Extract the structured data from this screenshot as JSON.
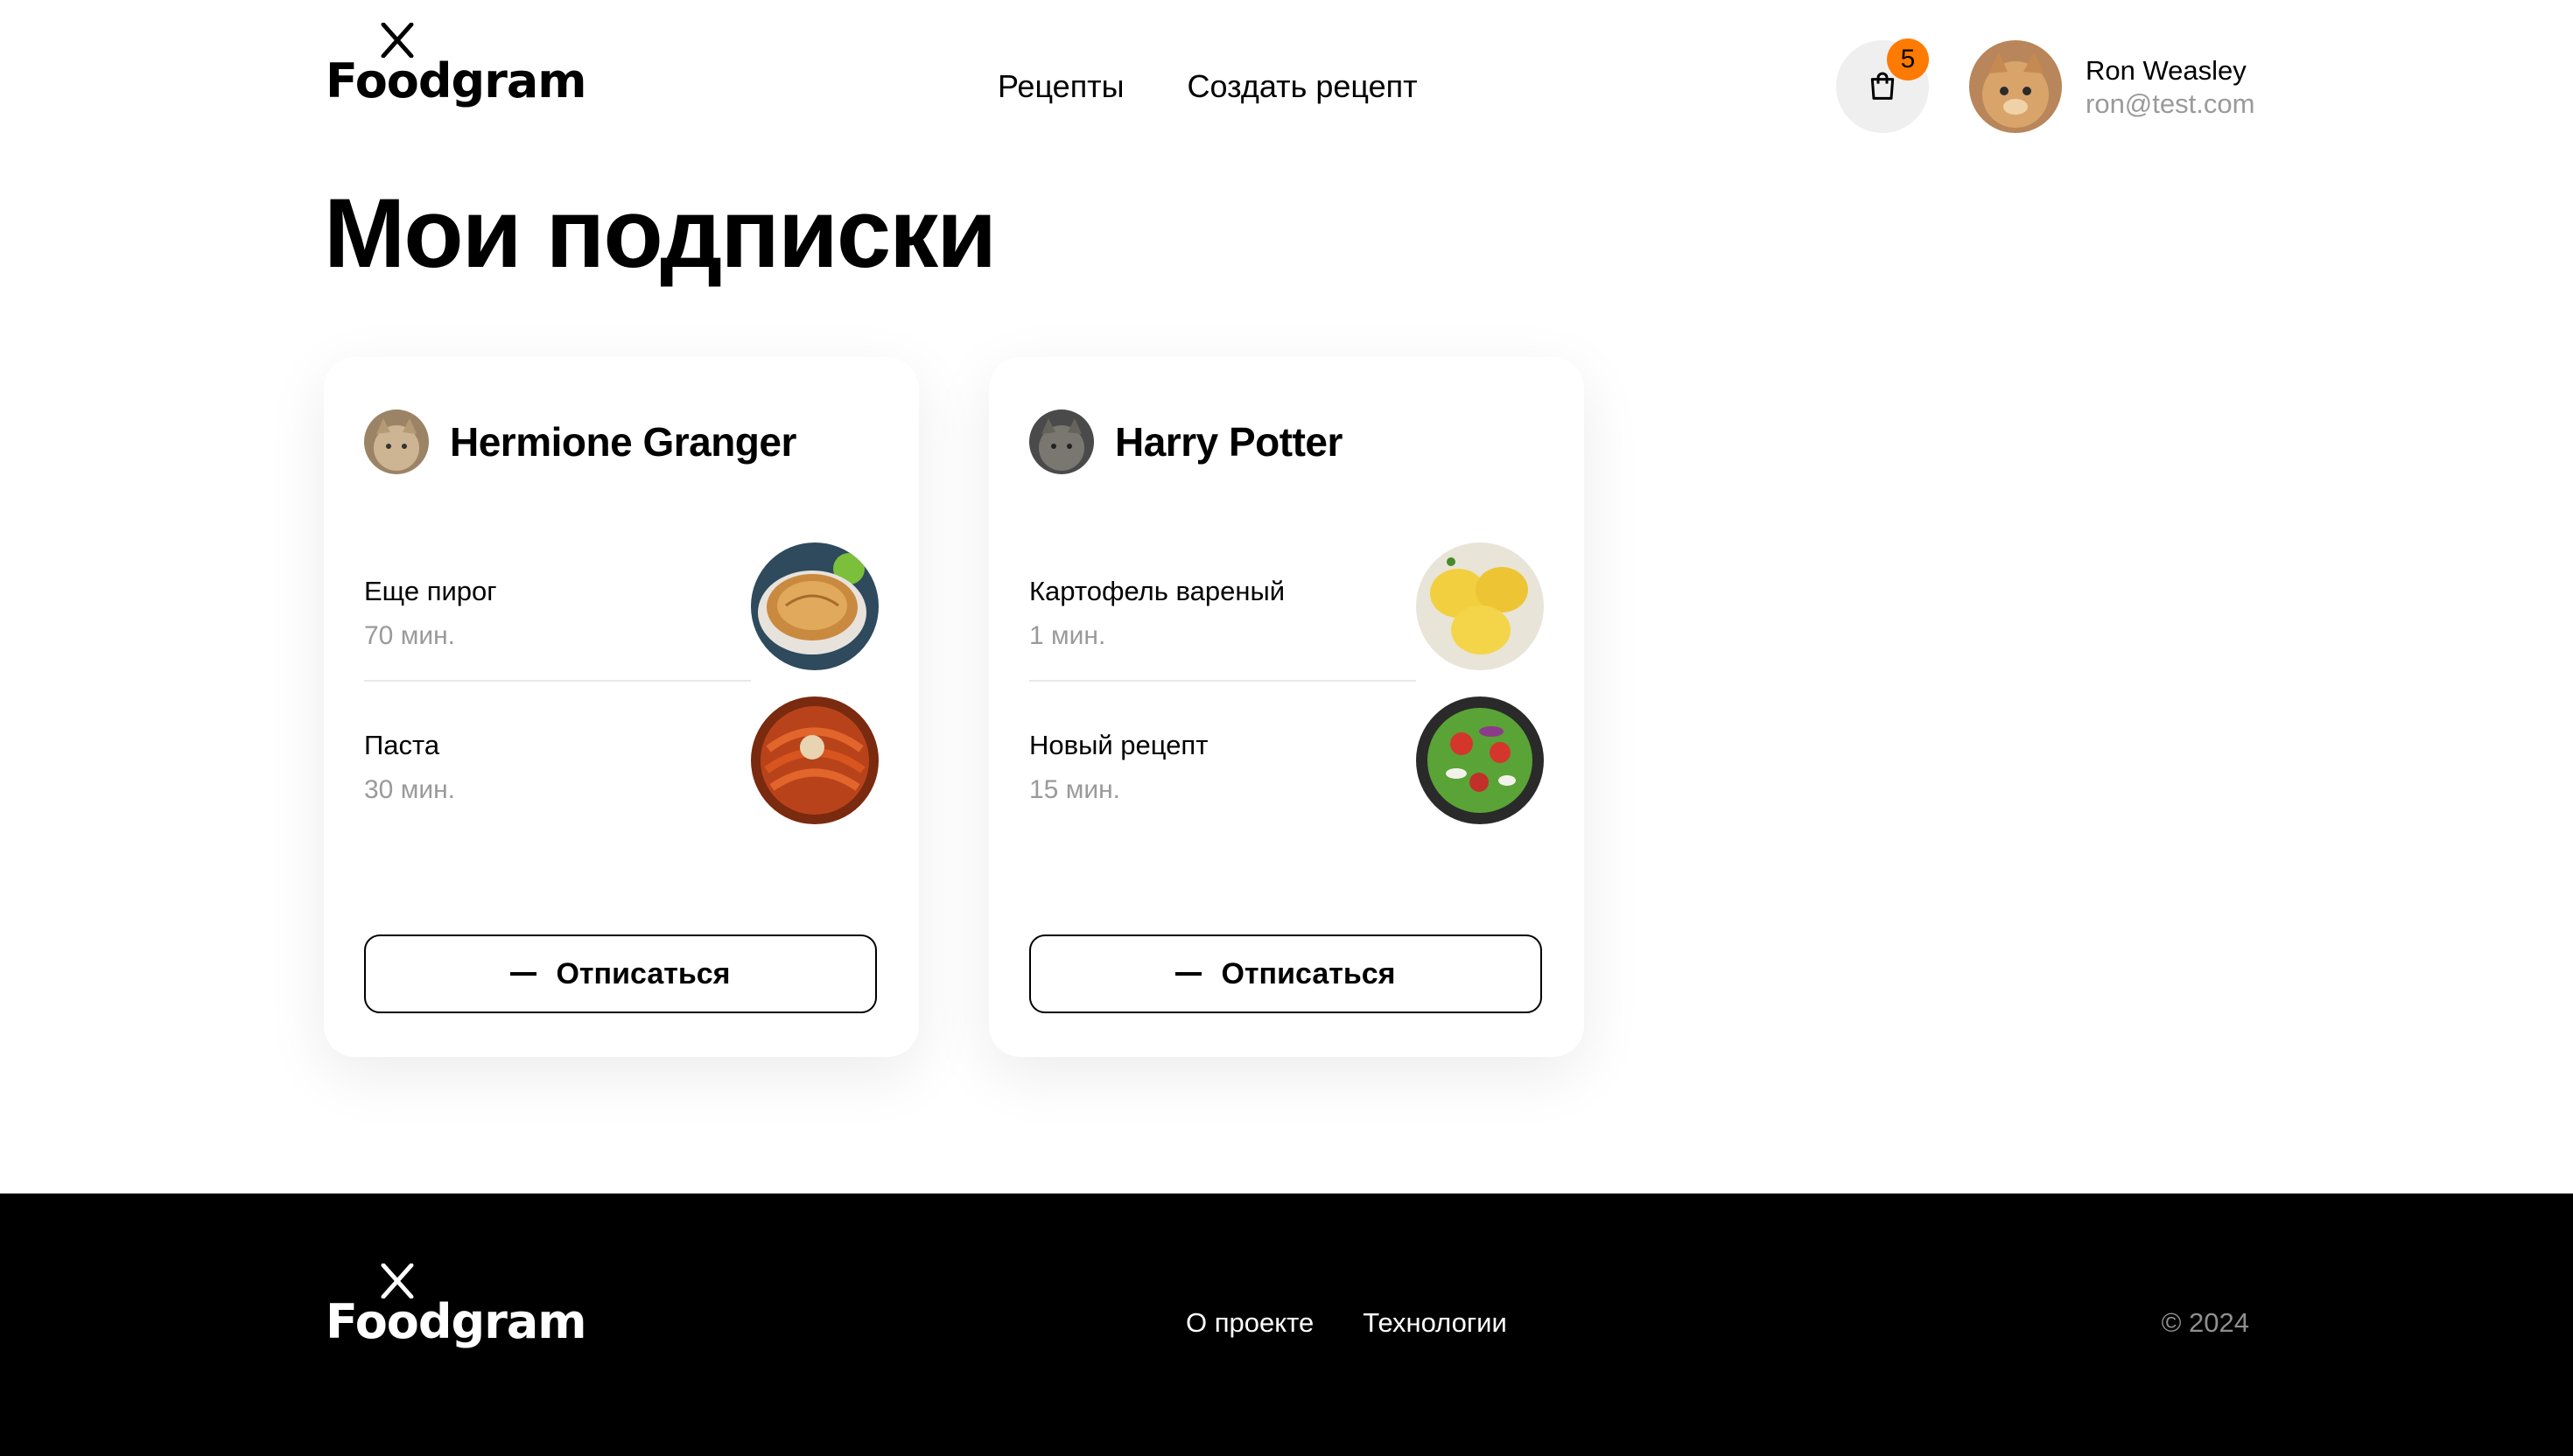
{
  "header": {
    "logo_text": "Foodgram",
    "nav": {
      "recipes": "Рецепты",
      "create": "Создать рецепт"
    },
    "cart_count": "5",
    "user": {
      "name": "Ron Weasley",
      "email": "ron@test.com"
    }
  },
  "main": {
    "title": "Мои подписки",
    "subscriptions": [
      {
        "author": "Hermione Granger",
        "recipes": [
          {
            "name": "Еще пирог",
            "time": "70 мин."
          },
          {
            "name": "Паста",
            "time": "30 мин."
          }
        ],
        "unsubscribe_label": "Отписаться"
      },
      {
        "author": "Harry Potter",
        "recipes": [
          {
            "name": "Картофель вареный",
            "time": "1 мин."
          },
          {
            "name": "Новый рецепт",
            "time": "15 мин."
          }
        ],
        "unsubscribe_label": "Отписаться"
      }
    ]
  },
  "footer": {
    "logo_text": "Foodgram",
    "links": {
      "about": "О проекте",
      "tech": "Технологии"
    },
    "copyright": "© 2024"
  },
  "colors": {
    "accent": "#ff7a00",
    "muted": "#9a9a9a",
    "footer_bg": "#000000"
  }
}
